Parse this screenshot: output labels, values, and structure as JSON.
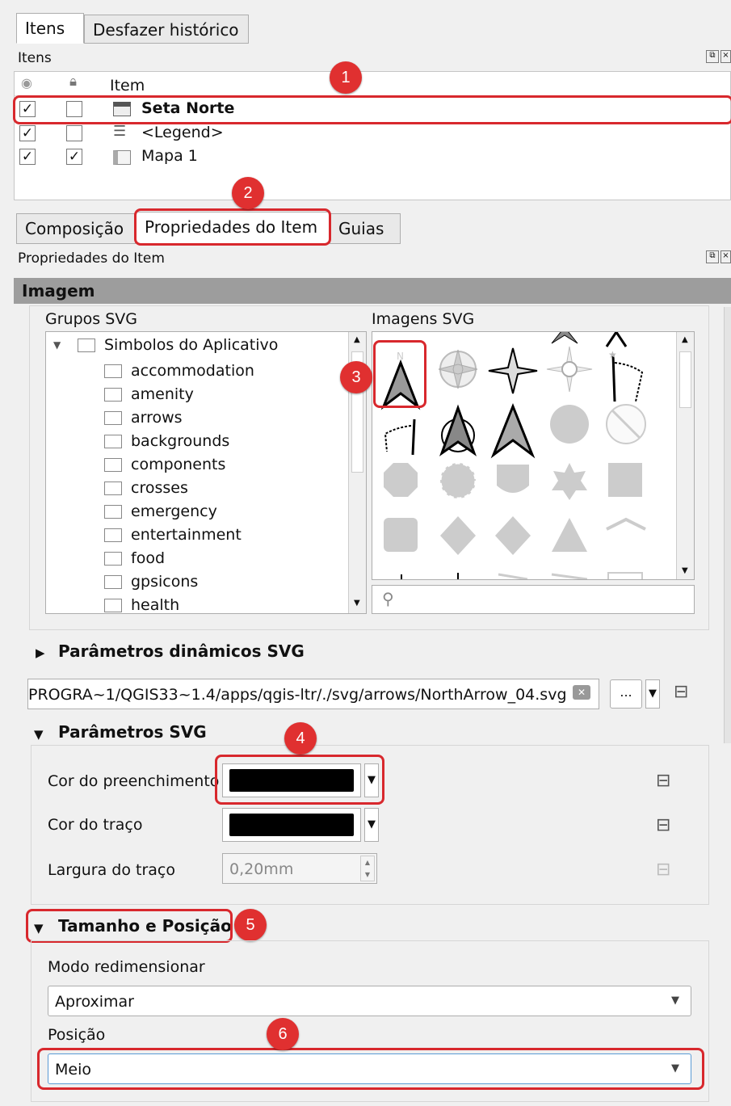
{
  "tabs_top": [
    "Itens",
    "Desfazer histórico"
  ],
  "items_panel": {
    "title": "Itens",
    "header_item": "Item",
    "rows": [
      {
        "visible": "✓",
        "locked": "",
        "name": "Seta Norte"
      },
      {
        "visible": "✓",
        "locked": "",
        "name": "<Legend>"
      },
      {
        "visible": "✓",
        "locked": "✓",
        "name": "Mapa 1"
      }
    ]
  },
  "tabs_mid": [
    "Composição",
    "Propriedades do Item",
    "Guias"
  ],
  "props_panel": {
    "title": "Propriedades do Item",
    "header": "Imagem",
    "svg_groups_label": "Grupos SVG",
    "svg_images_label": "Imagens SVG",
    "tree_root": "Simbolos do Aplicativo",
    "tree_items": [
      "accommodation",
      "amenity",
      "arrows",
      "backgrounds",
      "components",
      "crosses",
      "emergency",
      "entertainment",
      "food",
      "gpsicons",
      "health"
    ]
  },
  "dynamic_params": "Parâmetros dinâmicos SVG",
  "svg_path": "PROGRA~1/QGIS33~1.4/apps/qgis-ltr/./svg/arrows/NorthArrow_04.svg",
  "browse_label": "...",
  "svg_params": {
    "title": "Parâmetros SVG",
    "fill_label": "Cor do preenchimento",
    "stroke_label": "Cor do traço",
    "stroke_width_label": "Largura do traço",
    "stroke_width_value": "0,20mm",
    "fill_color": "#000000",
    "stroke_color": "#000000"
  },
  "size_pos": {
    "title": "Tamanho e Posição",
    "resize_label": "Modo redimensionar",
    "resize_value": "Aproximar",
    "position_label": "Posição",
    "position_value": "Meio"
  },
  "badges": [
    "1",
    "2",
    "3",
    "4",
    "5",
    "6"
  ],
  "accent_red": "#d8282d"
}
